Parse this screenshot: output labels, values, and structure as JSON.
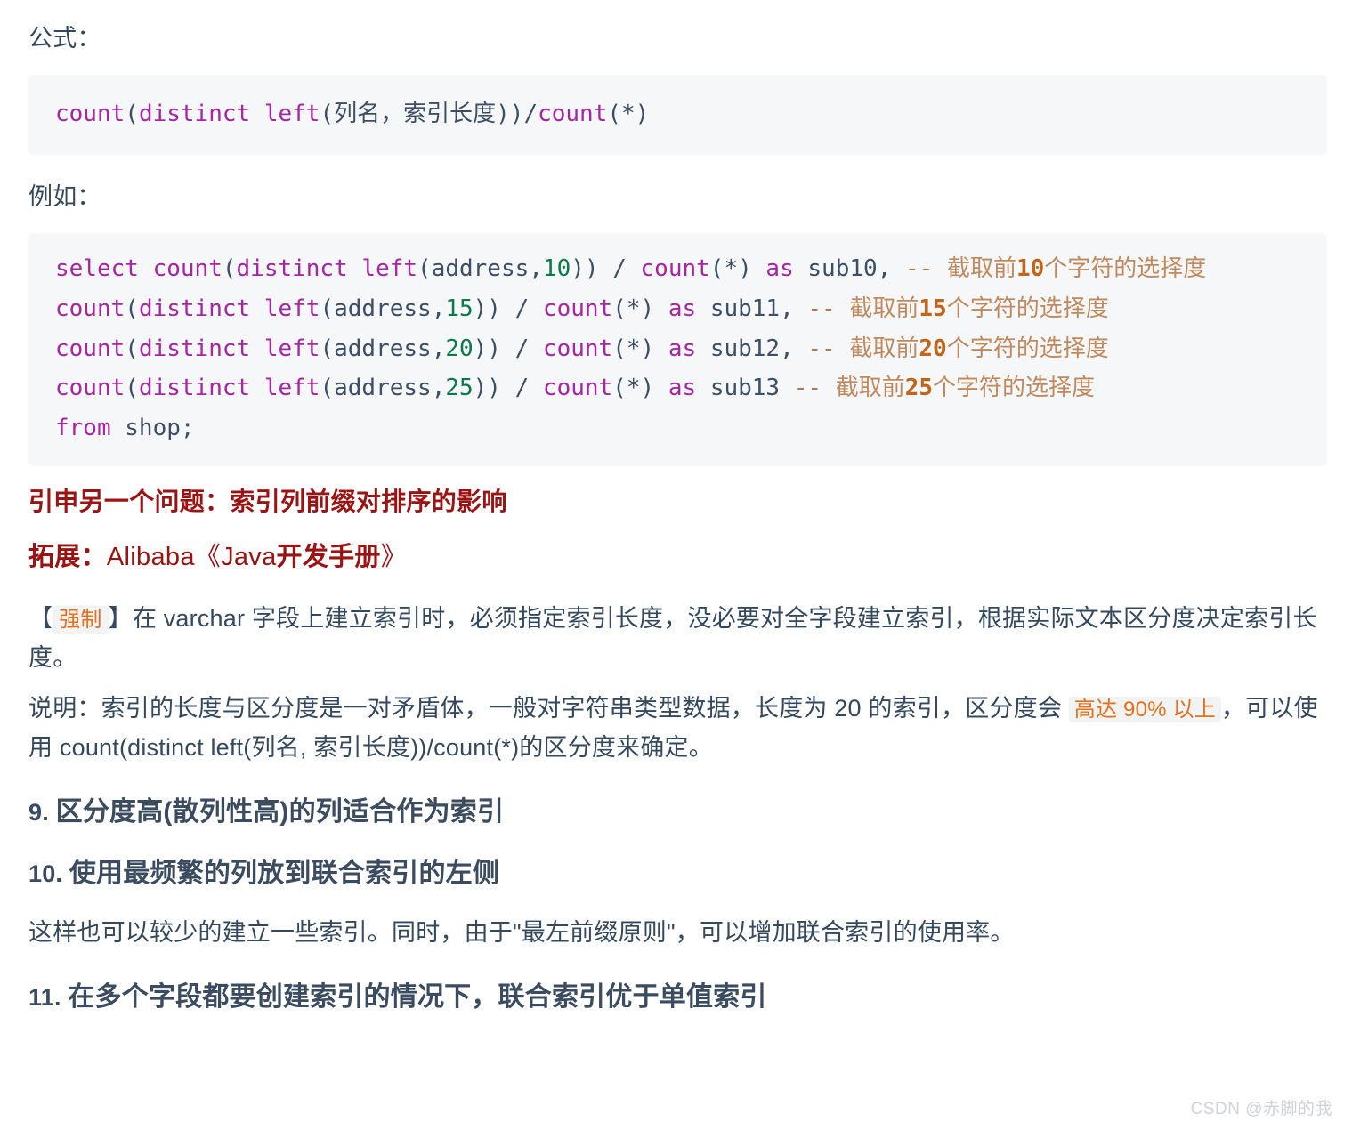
{
  "document": {
    "formula_label": "公式：",
    "example_label": "例如：",
    "formula_code": {
      "fn_count1": "count",
      "paren_open1": "(",
      "kw_distinct": "distinct ",
      "fn_left": "left",
      "paren_open2": "(",
      "cn_args": "列名，索引长度",
      "paren_close": "))",
      "slash": "/",
      "fn_count2": "count",
      "star_args": "(*)"
    },
    "sql_lines": [
      {
        "kw_select": "select ",
        "fn_count": "count",
        "p1": "(",
        "kw_distinct": "distinct ",
        "fn_left": "left",
        "p2": "(",
        "col": "address",
        "comma": ",",
        "num": "10",
        "p3": ")) ",
        "slash": "/ ",
        "fn_count2": "count",
        "star": "(*) ",
        "kw_as": "as ",
        "alias": "sub10",
        "trail": ",",
        "cmt_dash": "--",
        "cmt_pre": "截取前",
        "cmt_num": "10",
        "cmt_post": "个字符的选择度"
      },
      {
        "kw_select": "",
        "fn_count": "count",
        "p1": "(",
        "kw_distinct": "distinct ",
        "fn_left": "left",
        "p2": "(",
        "col": "address",
        "comma": ",",
        "num": "15",
        "p3": ")) ",
        "slash": "/ ",
        "fn_count2": "count",
        "star": "(*) ",
        "kw_as": "as ",
        "alias": "sub11",
        "trail": ",",
        "cmt_dash": "--",
        "cmt_pre": "截取前",
        "cmt_num": "15",
        "cmt_post": "个字符的选择度"
      },
      {
        "kw_select": "",
        "fn_count": "count",
        "p1": "(",
        "kw_distinct": "distinct ",
        "fn_left": "left",
        "p2": "(",
        "col": "address",
        "comma": ",",
        "num": "20",
        "p3": ")) ",
        "slash": "/ ",
        "fn_count2": "count",
        "star": "(*) ",
        "kw_as": "as ",
        "alias": "sub12",
        "trail": ",",
        "cmt_dash": "--",
        "cmt_pre": "截取前",
        "cmt_num": "20",
        "cmt_post": "个字符的选择度"
      },
      {
        "kw_select": "",
        "fn_count": "count",
        "p1": "(",
        "kw_distinct": "distinct ",
        "fn_left": "left",
        "p2": "(",
        "col": "address",
        "comma": ",",
        "num": "25",
        "p3": ")) ",
        "slash": "/ ",
        "fn_count2": "count",
        "star": "(*) ",
        "kw_as": "as ",
        "alias": "sub13",
        "trail": "",
        "cmt_dash": "--",
        "cmt_pre": "截取前",
        "cmt_num": "25",
        "cmt_post": "个字符的选择度"
      }
    ],
    "sql_last_line": {
      "kw_from": "from ",
      "table": "shop",
      "semi": ";"
    },
    "heading_extend": "引申另一个问题：索引列前缀对排序的影响",
    "heading_expand": {
      "label": "拓展：",
      "brand": "Alibaba",
      "book_open": "《",
      "book_java": "Java",
      "book_cn": "开发手册",
      "book_close": "》"
    },
    "mandatory_para": {
      "bracket_open": "【",
      "tag": "强制",
      "bracket_close": "】",
      "text": "在 varchar 字段上建立索引时，必须指定索引长度，没必要对全字段建立索引，根据实际文本区分度决定索引长度。"
    },
    "explain_para": {
      "lead": "说明：索引的长度与区分度是一对矛盾体，一般对字符串类型数据，长度为 20 的索引，区分度会 ",
      "highlight": "高达 90% 以上",
      "tail": "，可以使用 count(distinct left(列名, 索引长度))/count(*)的区分度来确定。"
    },
    "section9": {
      "num": "9. ",
      "title": "区分度高(散列性高)的列适合作为索引"
    },
    "section10": {
      "num": "10. ",
      "title": "使用最频繁的列放到联合索引的左侧",
      "body": "这样也可以较少的建立一些索引。同时，由于\"最左前缀原则\"，可以增加联合索引的使用率。"
    },
    "section11": {
      "num": "11. ",
      "title": "在多个字段都要创建索引的情况下，联合索引优于单值索引"
    },
    "watermark": "CSDN @赤脚的我",
    "colors": {
      "body_text": "#34495e",
      "heading_red": "#9c1313",
      "heading_slate": "#3b4c61",
      "code_bg": "#f6f7f8",
      "keyword": "#a626a4",
      "number": "#0b7a4b",
      "identifier": "#3d4f66",
      "comment": "#b07a52",
      "inline_code_text": "#e8701a",
      "inline_code_bg": "#f2f3f4",
      "watermark": "#cfd3d7"
    }
  }
}
